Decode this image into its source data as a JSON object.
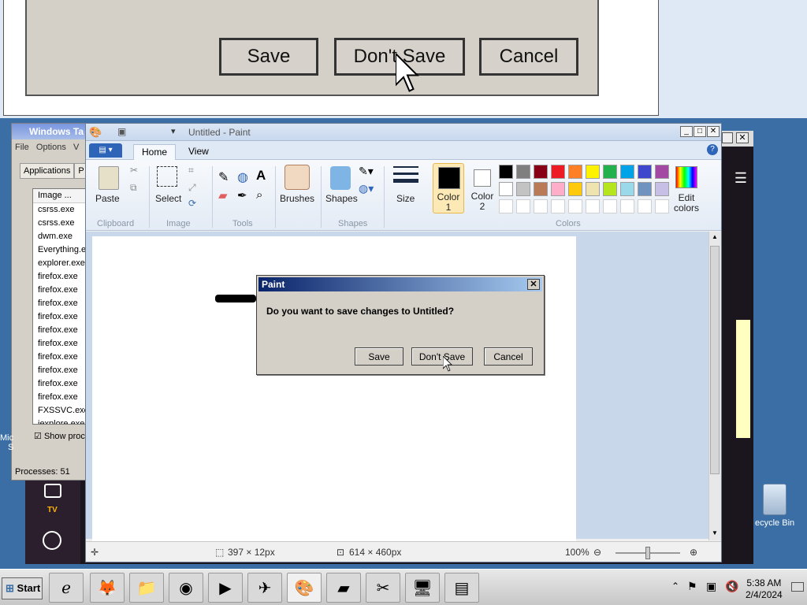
{
  "magnified": {
    "save": "Save",
    "dont_save": "Don't Save",
    "cancel": "Cancel"
  },
  "taskmgr": {
    "title": "Windows Ta",
    "menu": [
      "File",
      "Options",
      "V"
    ],
    "tabs": [
      "Applications",
      "P"
    ],
    "column_header": "Image ...",
    "processes": [
      "csrss.exe",
      "csrss.exe",
      "dwm.exe",
      "Everything.e",
      "explorer.exe",
      "firefox.exe",
      "firefox.exe",
      "firefox.exe",
      "firefox.exe",
      "firefox.exe",
      "firefox.exe",
      "firefox.exe",
      "firefox.exe",
      "firefox.exe",
      "firefox.exe",
      "FXSSVC.exe",
      "iexplore.exe"
    ],
    "show_processes": "Show proc",
    "status": "Processes: 51"
  },
  "media": {
    "tv_label": "TV"
  },
  "paint": {
    "title": "Untitled - Paint",
    "tabs": [
      "Home",
      "View"
    ],
    "groups": {
      "clipboard": "Clipboard",
      "image": "Image",
      "tools": "Tools",
      "shapes": "Shapes",
      "colors": "Colors"
    },
    "buttons": {
      "paste": "Paste",
      "select": "Select",
      "brushes": "Brushes",
      "shapes": "Shapes",
      "size": "Size",
      "color1": "Color 1",
      "color2": "Color 2",
      "edit_colors": "Edit colors"
    },
    "palette_row1": [
      "#000000",
      "#7f7f7f",
      "#880015",
      "#ed1c24",
      "#ff7f27",
      "#fff200",
      "#22b14c",
      "#00a2e8",
      "#3f48cc",
      "#a349a4"
    ],
    "palette_row2": [
      "#ffffff",
      "#c3c3c3",
      "#b97a57",
      "#ffaec9",
      "#ffc90e",
      "#efe4b0",
      "#b5e61d",
      "#99d9ea",
      "#7092be",
      "#c8bfe7"
    ],
    "status": {
      "selection_size": "397 × 12px",
      "canvas_size": "614 × 460px",
      "zoom": "100%"
    }
  },
  "dialog": {
    "title": "Paint",
    "message": "Do you want to save changes to Untitled?",
    "save": "Save",
    "dont_save": "Don't Save",
    "cancel": "Cancel"
  },
  "taskbar": {
    "start": "Start",
    "time": "5:38 AM",
    "date": "2/4/2024"
  },
  "desktop": {
    "recycle_bin": "ecycle Bin",
    "left_label_1": "Mic",
    "left_label_2": "S"
  }
}
